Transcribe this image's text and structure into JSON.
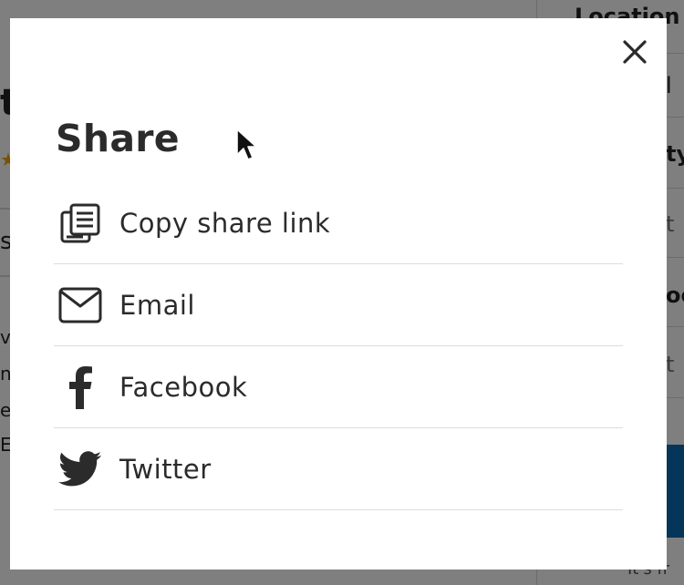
{
  "background": {
    "right_title": "Location",
    "right_lines": [
      "l",
      "ty",
      "t",
      "oc",
      "t"
    ],
    "bottom_text": "It's fr",
    "left_fragments": [
      "t",
      "s",
      "v",
      "n",
      "e",
      "E"
    ]
  },
  "modal": {
    "title": "Share",
    "close_icon": "close-icon",
    "items": [
      {
        "label": "Copy share link",
        "icon": "copy-link-icon"
      },
      {
        "label": "Email",
        "icon": "email-icon"
      },
      {
        "label": "Facebook",
        "icon": "facebook-icon"
      },
      {
        "label": "Twitter",
        "icon": "twitter-icon"
      }
    ]
  },
  "colors": {
    "text": "#2b2b2b",
    "divider": "#dcdcdc",
    "overlay": "rgba(0,0,0,0.5)",
    "accent_blue": "#0a6ab2",
    "star": "#f0a500"
  }
}
